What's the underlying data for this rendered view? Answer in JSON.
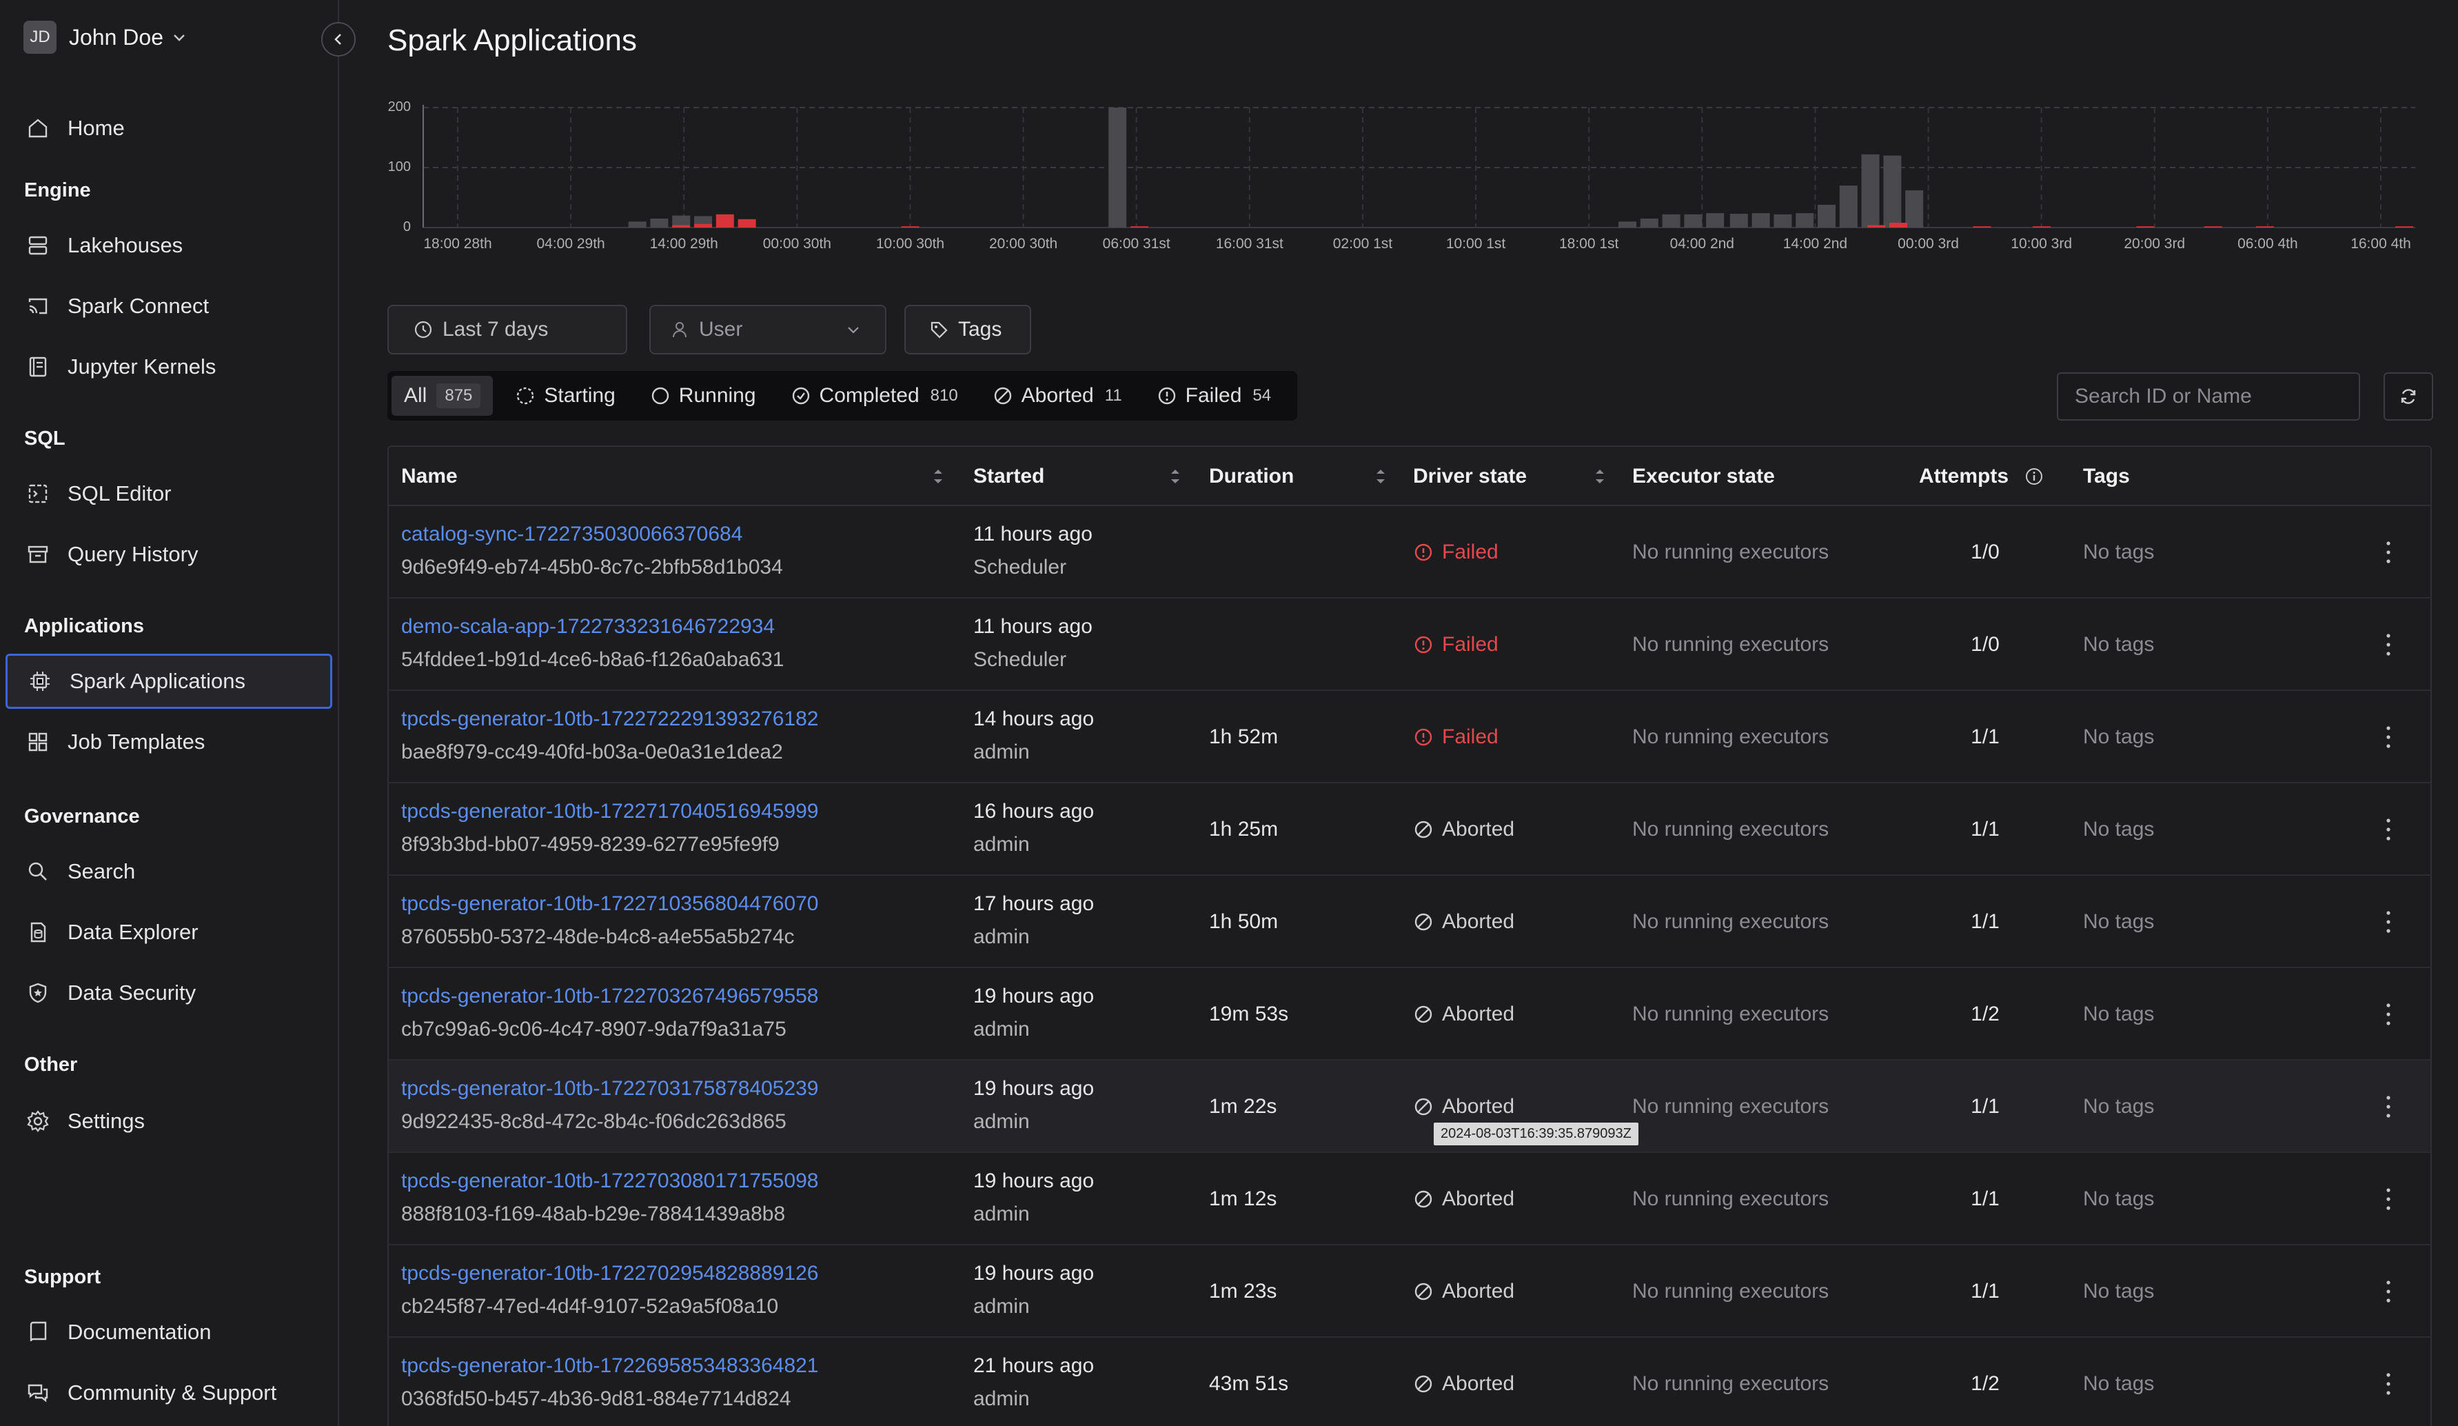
{
  "user": {
    "initials": "JD",
    "name": "John Doe"
  },
  "nav": {
    "home": "Home",
    "engine_title": "Engine",
    "lakehouses": "Lakehouses",
    "spark_connect": "Spark Connect",
    "jupyter": "Jupyter Kernels",
    "sql_title": "SQL",
    "sql_editor": "SQL Editor",
    "query_history": "Query History",
    "applications_title": "Applications",
    "spark_apps": "Spark Applications",
    "job_templates": "Job Templates",
    "governance_title": "Governance",
    "search": "Search",
    "data_explorer": "Data Explorer",
    "data_security": "Data Security",
    "other_title": "Other",
    "settings": "Settings",
    "support_title": "Support",
    "documentation": "Documentation",
    "community": "Community & Support"
  },
  "page": {
    "title": "Spark Applications"
  },
  "filters": {
    "range": "Last 7 days",
    "user": "User",
    "tags": "Tags"
  },
  "tabs": [
    {
      "label": "All",
      "count": "875"
    },
    {
      "label": "Starting",
      "count": ""
    },
    {
      "label": "Running",
      "count": ""
    },
    {
      "label": "Completed",
      "count": "810"
    },
    {
      "label": "Aborted",
      "count": "11"
    },
    {
      "label": "Failed",
      "count": "54"
    }
  ],
  "search": {
    "placeholder": "Search ID or Name"
  },
  "columns": {
    "name": "Name",
    "started": "Started",
    "duration": "Duration",
    "driver": "Driver state",
    "executor": "Executor state",
    "attempts": "Attempts",
    "tags": "Tags"
  },
  "rows": [
    {
      "name": "catalog-sync-1722735030066370684",
      "id": "9d6e9f49-eb74-45b0-8c7c-2bfb58d1b034",
      "started": "11 hours ago",
      "by": "Scheduler",
      "duration": "",
      "state": "Failed",
      "executor": "No running executors",
      "attempts": "1/0",
      "tags": "No tags"
    },
    {
      "name": "demo-scala-app-1722733231646722934",
      "id": "54fddee1-b91d-4ce6-b8a6-f126a0aba631",
      "started": "11 hours ago",
      "by": "Scheduler",
      "duration": "",
      "state": "Failed",
      "executor": "No running executors",
      "attempts": "1/0",
      "tags": "No tags"
    },
    {
      "name": "tpcds-generator-10tb-1722722291393276182",
      "id": "bae8f979-cc49-40fd-b03a-0e0a31e1dea2",
      "started": "14 hours ago",
      "by": "admin",
      "duration": "1h 52m",
      "state": "Failed",
      "executor": "No running executors",
      "attempts": "1/1",
      "tags": "No tags"
    },
    {
      "name": "tpcds-generator-10tb-1722717040516945999",
      "id": "8f93b3bd-bb07-4959-8239-6277e95fe9f9",
      "started": "16 hours ago",
      "by": "admin",
      "duration": "1h 25m",
      "state": "Aborted",
      "executor": "No running executors",
      "attempts": "1/1",
      "tags": "No tags"
    },
    {
      "name": "tpcds-generator-10tb-1722710356804476070",
      "id": "876055b0-5372-48de-b4c8-a4e55a5b274c",
      "started": "17 hours ago",
      "by": "admin",
      "duration": "1h 50m",
      "state": "Aborted",
      "executor": "No running executors",
      "attempts": "1/1",
      "tags": "No tags"
    },
    {
      "name": "tpcds-generator-10tb-1722703267496579558",
      "id": "cb7c99a6-9c06-4c47-8907-9da7f9a31a75",
      "started": "19 hours ago",
      "by": "admin",
      "duration": "19m 53s",
      "state": "Aborted",
      "executor": "No running executors",
      "attempts": "1/2",
      "tags": "No tags"
    },
    {
      "name": "tpcds-generator-10tb-1722703175878405239",
      "id": "9d922435-8c8d-472c-8b4c-f06dc263d865",
      "started": "19 hours ago",
      "by": "admin",
      "duration": "1m 22s",
      "state": "Aborted",
      "executor": "No running executors",
      "attempts": "1/1",
      "tags": "No tags"
    },
    {
      "name": "tpcds-generator-10tb-1722703080171755098",
      "id": "888f8103-f169-48ab-b29e-78841439a8b8",
      "started": "19 hours ago",
      "by": "admin",
      "duration": "1m 12s",
      "state": "Aborted",
      "executor": "No running executors",
      "attempts": "1/1",
      "tags": "No tags"
    },
    {
      "name": "tpcds-generator-10tb-1722702954828889126",
      "id": "cb245f87-47ed-4d4f-9107-52a9a5f08a10",
      "started": "19 hours ago",
      "by": "admin",
      "duration": "1m 23s",
      "state": "Aborted",
      "executor": "No running executors",
      "attempts": "1/1",
      "tags": "No tags"
    },
    {
      "name": "tpcds-generator-10tb-1722695853483364821",
      "id": "0368fd50-b457-4b36-9d81-884e7714d824",
      "started": "21 hours ago",
      "by": "admin",
      "duration": "43m 51s",
      "state": "Aborted",
      "executor": "No running executors",
      "attempts": "1/2",
      "tags": "No tags"
    }
  ],
  "tooltip": "2024-08-03T16:39:35.879093Z",
  "colors": {
    "accent": "#3d64d8",
    "link": "#5b8def",
    "failed": "#e5484d",
    "bar": "#4a4a4e"
  },
  "chart_data": {
    "type": "bar",
    "ylim": [
      0,
      200
    ],
    "yticks": [
      "200",
      "100",
      "0"
    ],
    "xticks": [
      "18:00 28th",
      "04:00 29th",
      "14:00 29th",
      "00:00 30th",
      "10:00 30th",
      "20:00 30th",
      "06:00 31st",
      "16:00 31st",
      "02:00 1st",
      "10:00 1st",
      "18:00 1st",
      "04:00 2nd",
      "14:00 2nd",
      "00:00 3rd",
      "10:00 3rd",
      "20:00 3rd",
      "06:00 4th",
      "16:00 4th"
    ],
    "series": [
      {
        "kind": "completed",
        "bars": [
          [
            0.103,
            10
          ],
          [
            0.114,
            15
          ],
          [
            0.125,
            20
          ],
          [
            0.136,
            19
          ],
          [
            0.344,
            200
          ],
          [
            0.6,
            10
          ],
          [
            0.611,
            15
          ],
          [
            0.622,
            22
          ],
          [
            0.633,
            22
          ],
          [
            0.644,
            24
          ],
          [
            0.656,
            23
          ],
          [
            0.667,
            24
          ],
          [
            0.678,
            22
          ],
          [
            0.689,
            24
          ],
          [
            0.7,
            38
          ],
          [
            0.711,
            70
          ],
          [
            0.722,
            122
          ],
          [
            0.733,
            120
          ],
          [
            0.744,
            62
          ]
        ]
      },
      {
        "kind": "failed",
        "bars": [
          [
            0.125,
            4
          ],
          [
            0.136,
            6
          ],
          [
            0.147,
            22
          ],
          [
            0.158,
            14
          ],
          [
            0.24,
            2
          ],
          [
            0.355,
            2
          ],
          [
            0.725,
            4
          ],
          [
            0.736,
            8
          ],
          [
            0.778,
            2
          ],
          [
            0.808,
            2
          ],
          [
            0.86,
            2
          ],
          [
            0.894,
            2
          ],
          [
            0.92,
            2
          ],
          [
            0.99,
            2
          ]
        ]
      }
    ]
  }
}
